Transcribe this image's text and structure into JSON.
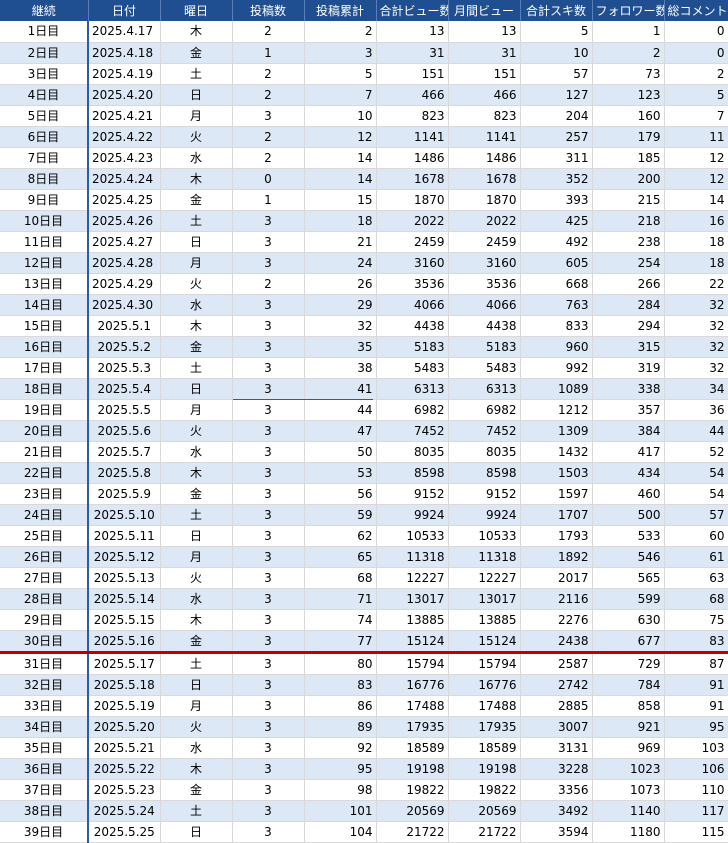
{
  "headers": [
    "継続",
    "日付",
    "曜日",
    "投稿数",
    "投稿累計",
    "合計ビュー数",
    "月間ビュー",
    "合計スキ数",
    "フォロワー数",
    "総コメント"
  ],
  "rows": [
    [
      "1日目",
      "2025.4.17",
      "木",
      "2",
      "2",
      "13",
      "13",
      "5",
      "1",
      "0"
    ],
    [
      "2日目",
      "2025.4.18",
      "金",
      "1",
      "3",
      "31",
      "31",
      "10",
      "2",
      "0"
    ],
    [
      "3日目",
      "2025.4.19",
      "土",
      "2",
      "5",
      "151",
      "151",
      "57",
      "73",
      "2"
    ],
    [
      "4日目",
      "2025.4.20",
      "日",
      "2",
      "7",
      "466",
      "466",
      "127",
      "123",
      "5"
    ],
    [
      "5日目",
      "2025.4.21",
      "月",
      "3",
      "10",
      "823",
      "823",
      "204",
      "160",
      "7"
    ],
    [
      "6日目",
      "2025.4.22",
      "火",
      "2",
      "12",
      "1141",
      "1141",
      "257",
      "179",
      "11"
    ],
    [
      "7日目",
      "2025.4.23",
      "水",
      "2",
      "14",
      "1486",
      "1486",
      "311",
      "185",
      "12"
    ],
    [
      "8日目",
      "2025.4.24",
      "木",
      "0",
      "14",
      "1678",
      "1678",
      "352",
      "200",
      "12"
    ],
    [
      "9日目",
      "2025.4.25",
      "金",
      "1",
      "15",
      "1870",
      "1870",
      "393",
      "215",
      "14"
    ],
    [
      "10日目",
      "2025.4.26",
      "土",
      "3",
      "18",
      "2022",
      "2022",
      "425",
      "218",
      "16"
    ],
    [
      "11日目",
      "2025.4.27",
      "日",
      "3",
      "21",
      "2459",
      "2459",
      "492",
      "238",
      "18"
    ],
    [
      "12日目",
      "2025.4.28",
      "月",
      "3",
      "24",
      "3160",
      "3160",
      "605",
      "254",
      "18"
    ],
    [
      "13日目",
      "2025.4.29",
      "火",
      "2",
      "26",
      "3536",
      "3536",
      "668",
      "266",
      "22"
    ],
    [
      "14日目",
      "2025.4.30",
      "水",
      "3",
      "29",
      "4066",
      "4066",
      "763",
      "284",
      "32"
    ],
    [
      "15日目",
      "2025.5.1",
      "木",
      "3",
      "32",
      "4438",
      "4438",
      "833",
      "294",
      "32"
    ],
    [
      "16日目",
      "2025.5.2",
      "金",
      "3",
      "35",
      "5183",
      "5183",
      "960",
      "315",
      "32"
    ],
    [
      "17日目",
      "2025.5.3",
      "土",
      "3",
      "38",
      "5483",
      "5483",
      "992",
      "319",
      "32"
    ],
    [
      "18日目",
      "2025.5.4",
      "日",
      "3",
      "41",
      "6313",
      "6313",
      "1089",
      "338",
      "34"
    ],
    [
      "19日目",
      "2025.5.5",
      "月",
      "3",
      "44",
      "6982",
      "6982",
      "1212",
      "357",
      "36"
    ],
    [
      "20日目",
      "2025.5.6",
      "火",
      "3",
      "47",
      "7452",
      "7452",
      "1309",
      "384",
      "44"
    ],
    [
      "21日目",
      "2025.5.7",
      "水",
      "3",
      "50",
      "8035",
      "8035",
      "1432",
      "417",
      "52"
    ],
    [
      "22日目",
      "2025.5.8",
      "木",
      "3",
      "53",
      "8598",
      "8598",
      "1503",
      "434",
      "54"
    ],
    [
      "23日目",
      "2025.5.9",
      "金",
      "3",
      "56",
      "9152",
      "9152",
      "1597",
      "460",
      "54"
    ],
    [
      "24日目",
      "2025.5.10",
      "土",
      "3",
      "59",
      "9924",
      "9924",
      "1707",
      "500",
      "57"
    ],
    [
      "25日目",
      "2025.5.11",
      "日",
      "3",
      "62",
      "10533",
      "10533",
      "1793",
      "533",
      "60"
    ],
    [
      "26日目",
      "2025.5.12",
      "月",
      "3",
      "65",
      "11318",
      "11318",
      "1892",
      "546",
      "61"
    ],
    [
      "27日目",
      "2025.5.13",
      "火",
      "3",
      "68",
      "12227",
      "12227",
      "2017",
      "565",
      "63"
    ],
    [
      "28日目",
      "2025.5.14",
      "水",
      "3",
      "71",
      "13017",
      "13017",
      "2116",
      "599",
      "68"
    ],
    [
      "29日目",
      "2025.5.15",
      "木",
      "3",
      "74",
      "13885",
      "13885",
      "2276",
      "630",
      "75"
    ],
    [
      "30日目",
      "2025.5.16",
      "金",
      "3",
      "77",
      "15124",
      "15124",
      "2438",
      "677",
      "83"
    ],
    [
      "31日目",
      "2025.5.17",
      "土",
      "3",
      "80",
      "15794",
      "15794",
      "2587",
      "729",
      "87"
    ],
    [
      "32日目",
      "2025.5.18",
      "日",
      "3",
      "83",
      "16776",
      "16776",
      "2742",
      "784",
      "91"
    ],
    [
      "33日目",
      "2025.5.19",
      "月",
      "3",
      "86",
      "17488",
      "17488",
      "2885",
      "858",
      "91"
    ],
    [
      "34日目",
      "2025.5.20",
      "火",
      "3",
      "89",
      "17935",
      "17935",
      "3007",
      "921",
      "95"
    ],
    [
      "35日目",
      "2025.5.21",
      "水",
      "3",
      "92",
      "18589",
      "18589",
      "3131",
      "969",
      "103"
    ],
    [
      "36日目",
      "2025.5.22",
      "木",
      "3",
      "95",
      "19198",
      "19198",
      "3228",
      "1023",
      "106"
    ],
    [
      "37日目",
      "2025.5.23",
      "金",
      "3",
      "98",
      "19822",
      "19822",
      "3356",
      "1073",
      "110"
    ],
    [
      "38日目",
      "2025.5.24",
      "土",
      "3",
      "101",
      "20569",
      "20569",
      "3492",
      "1140",
      "117"
    ],
    [
      "39日目",
      "2025.5.25",
      "日",
      "3",
      "104",
      "21722",
      "21722",
      "3594",
      "1180",
      "115"
    ]
  ],
  "colors": {
    "header_bg": "#1f4e91",
    "alt_row": "#dde8f7",
    "separator": "#c00000"
  }
}
